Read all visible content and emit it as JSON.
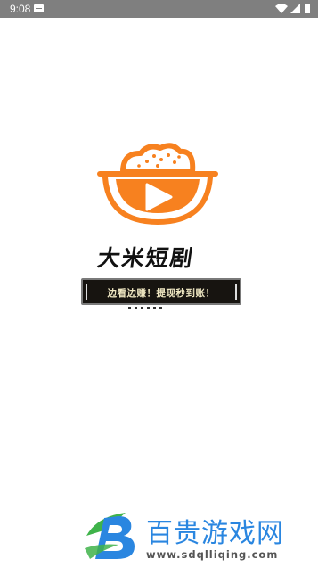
{
  "status_bar": {
    "time": "9:08",
    "icons": [
      "notification-icon",
      "wifi-icon",
      "signal-icon",
      "battery-icon"
    ]
  },
  "splash": {
    "logo_icon": "rice-bowl-play-icon",
    "app_name": "大米短剧",
    "slogan": "边看边赚！提现秒到账！"
  },
  "watermark": {
    "logo_icon": "b-logo-icon",
    "title": "百贵游戏网",
    "url": "www.sdqlliqing.com"
  },
  "colors": {
    "status_bar_bg": "#7f7f7f",
    "brand_orange": "#f7811f",
    "slogan_bg": "#171410",
    "slogan_text": "#efe7c2",
    "watermark_blue": "#2a86e0",
    "watermark_green": "#3fb34a"
  }
}
